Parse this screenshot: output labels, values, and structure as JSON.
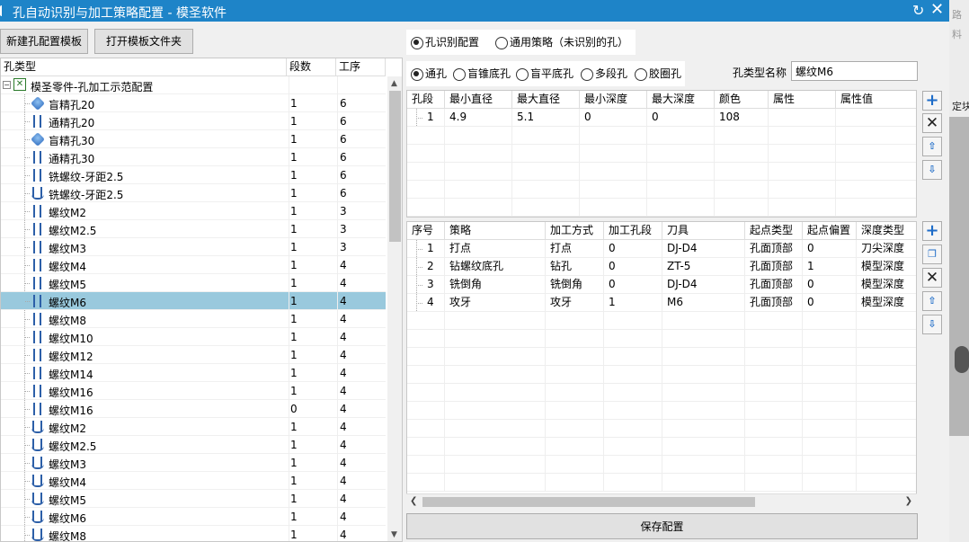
{
  "window": {
    "title": "孔自动识别与加工策略配置 - 模圣软件"
  },
  "bg_right": {
    "t1": "路",
    "t2": "料",
    "t3": "定块"
  },
  "toolbar": {
    "new_template": "新建孔配置模板",
    "open_folder": "打开模板文件夹"
  },
  "tree": {
    "headers": [
      "孔类型",
      "段数",
      "工序"
    ],
    "root": "模圣零件-孔加工示范配置",
    "rows": [
      {
        "name": "盲精孔20",
        "seg": "1",
        "op": "6",
        "icon": "blind-hole-icon"
      },
      {
        "name": "通精孔20",
        "seg": "1",
        "op": "6",
        "icon": "through-hole-icon"
      },
      {
        "name": "盲精孔30",
        "seg": "1",
        "op": "6",
        "icon": "blind-hole-icon"
      },
      {
        "name": "通精孔30",
        "seg": "1",
        "op": "6",
        "icon": "through-hole-icon"
      },
      {
        "name": "铣螺纹-牙距2.5",
        "seg": "1",
        "op": "6",
        "icon": "through-hole-icon"
      },
      {
        "name": "铣螺纹-牙距2.5",
        "seg": "1",
        "op": "6",
        "icon": "tapped-blind-hole-icon"
      },
      {
        "name": "螺纹M2",
        "seg": "1",
        "op": "3",
        "icon": "through-hole-icon"
      },
      {
        "name": "螺纹M2.5",
        "seg": "1",
        "op": "3",
        "icon": "through-hole-icon"
      },
      {
        "name": "螺纹M3",
        "seg": "1",
        "op": "3",
        "icon": "through-hole-icon"
      },
      {
        "name": "螺纹M4",
        "seg": "1",
        "op": "4",
        "icon": "through-hole-icon"
      },
      {
        "name": "螺纹M5",
        "seg": "1",
        "op": "4",
        "icon": "through-hole-icon"
      },
      {
        "name": "螺纹M6",
        "seg": "1",
        "op": "4",
        "icon": "through-hole-icon",
        "selected": true
      },
      {
        "name": "螺纹M8",
        "seg": "1",
        "op": "4",
        "icon": "through-hole-icon"
      },
      {
        "name": "螺纹M10",
        "seg": "1",
        "op": "4",
        "icon": "through-hole-icon"
      },
      {
        "name": "螺纹M12",
        "seg": "1",
        "op": "4",
        "icon": "through-hole-icon"
      },
      {
        "name": "螺纹M14",
        "seg": "1",
        "op": "4",
        "icon": "through-hole-icon"
      },
      {
        "name": "螺纹M16",
        "seg": "1",
        "op": "4",
        "icon": "through-hole-icon"
      },
      {
        "name": "螺纹M16",
        "seg": "0",
        "op": "4",
        "icon": "through-hole-icon"
      },
      {
        "name": "螺纹M2",
        "seg": "1",
        "op": "4",
        "icon": "tapped-blind-hole-icon"
      },
      {
        "name": "螺纹M2.5",
        "seg": "1",
        "op": "4",
        "icon": "tapped-blind-hole-icon"
      },
      {
        "name": "螺纹M3",
        "seg": "1",
        "op": "4",
        "icon": "tapped-blind-hole-icon"
      },
      {
        "name": "螺纹M4",
        "seg": "1",
        "op": "4",
        "icon": "tapped-blind-hole-icon"
      },
      {
        "name": "螺纹M5",
        "seg": "1",
        "op": "4",
        "icon": "tapped-blind-hole-icon"
      },
      {
        "name": "螺纹M6",
        "seg": "1",
        "op": "4",
        "icon": "tapped-blind-hole-icon"
      },
      {
        "name": "螺纹M8",
        "seg": "1",
        "op": "4",
        "icon": "tapped-blind-hole-icon"
      }
    ]
  },
  "mode": {
    "options": [
      "孔识别配置",
      "通用策略（未识别的孔）"
    ],
    "selected": 0
  },
  "holetype": {
    "options": [
      "通孔",
      "盲锥底孔",
      "盲平底孔",
      "多段孔",
      "胶圈孔"
    ],
    "selected": 0
  },
  "name_field": {
    "label": "孔类型名称",
    "value": "螺纹M6"
  },
  "seg_grid": {
    "headers": [
      "孔段",
      "最小直径",
      "最大直径",
      "最小深度",
      "最大深度",
      "颜色",
      "属性",
      "属性值"
    ],
    "rows": [
      [
        "1",
        "4.9",
        "5.1",
        "0",
        "0",
        "108",
        "",
        ""
      ]
    ]
  },
  "strategy_grid": {
    "headers": [
      "序号",
      "策略",
      "加工方式",
      "加工孔段",
      "刀具",
      "起点类型",
      "起点偏置",
      "深度类型"
    ],
    "rows": [
      [
        "1",
        "打点",
        "打点",
        "0",
        "DJ-D4",
        "孔面顶部",
        "0",
        "刀尖深度"
      ],
      [
        "2",
        "钻螺纹底孔",
        "钻孔",
        "0",
        "ZT-5",
        "孔面顶部",
        "1",
        "模型深度"
      ],
      [
        "3",
        "铣倒角",
        "铣倒角",
        "0",
        "DJ-D4",
        "孔面顶部",
        "0",
        "模型深度"
      ],
      [
        "4",
        "攻牙",
        "攻牙",
        "1",
        "M6",
        "孔面顶部",
        "0",
        "模型深度"
      ]
    ]
  },
  "save_label": "保存配置",
  "colors": {
    "title_bar": "#1e84c8",
    "selection": "#99c9dd",
    "accent": "#1e6cc8"
  }
}
